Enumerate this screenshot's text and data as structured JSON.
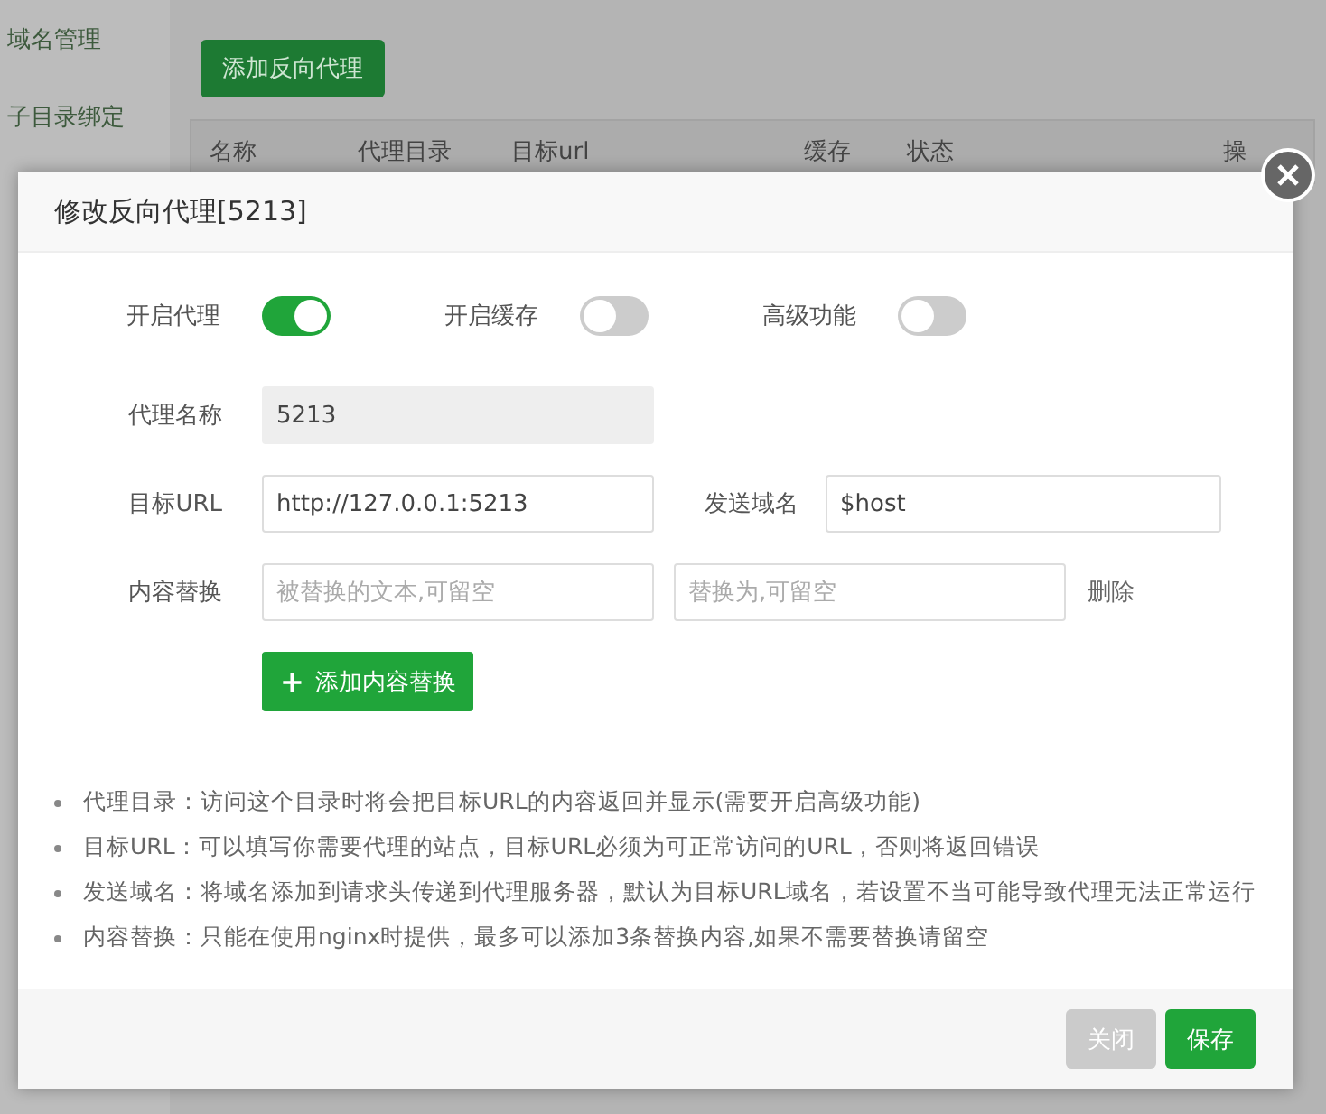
{
  "sidebar": {
    "items": [
      {
        "label": "域名管理"
      },
      {
        "label": "子目录绑定"
      }
    ]
  },
  "toolbar": {
    "add_button": "添加反向代理"
  },
  "table": {
    "columns": [
      "名称",
      "代理目录",
      "目标url",
      "缓存",
      "状态",
      "操"
    ]
  },
  "dialog": {
    "title": "修改反向代理[5213]",
    "toggles": [
      {
        "label": "开启代理",
        "on": true
      },
      {
        "label": "开启缓存",
        "on": false
      },
      {
        "label": "高级功能",
        "on": false
      }
    ],
    "proxy_name": {
      "label": "代理名称",
      "value": "5213",
      "disabled": true
    },
    "target_url": {
      "label": "目标URL",
      "value": "http://127.0.0.1:5213"
    },
    "send_domain": {
      "label": "发送域名",
      "value": "$host"
    },
    "content_replace": {
      "label": "内容替换",
      "from_placeholder": "被替换的文本,可留空",
      "to_placeholder": "替换为,可留空",
      "delete_link": "删除"
    },
    "add_replace_button": {
      "icon": "+",
      "label": "添加内容替换"
    },
    "notes": [
      "代理目录：访问这个目录时将会把目标URL的内容返回并显示(需要开启高级功能)",
      "目标URL：可以填写你需要代理的站点，目标URL必须为可正常访问的URL，否则将返回错误",
      "发送域名：将域名添加到请求头传递到代理服务器，默认为目标URL域名，若设置不当可能导致代理无法正常运行",
      "内容替换：只能在使用nginx时提供，最多可以添加3条替换内容,如果不需要替换请留空"
    ],
    "buttons": [
      {
        "label": "关闭",
        "kind": "secondary"
      },
      {
        "label": "保存",
        "kind": "primary"
      }
    ]
  }
}
